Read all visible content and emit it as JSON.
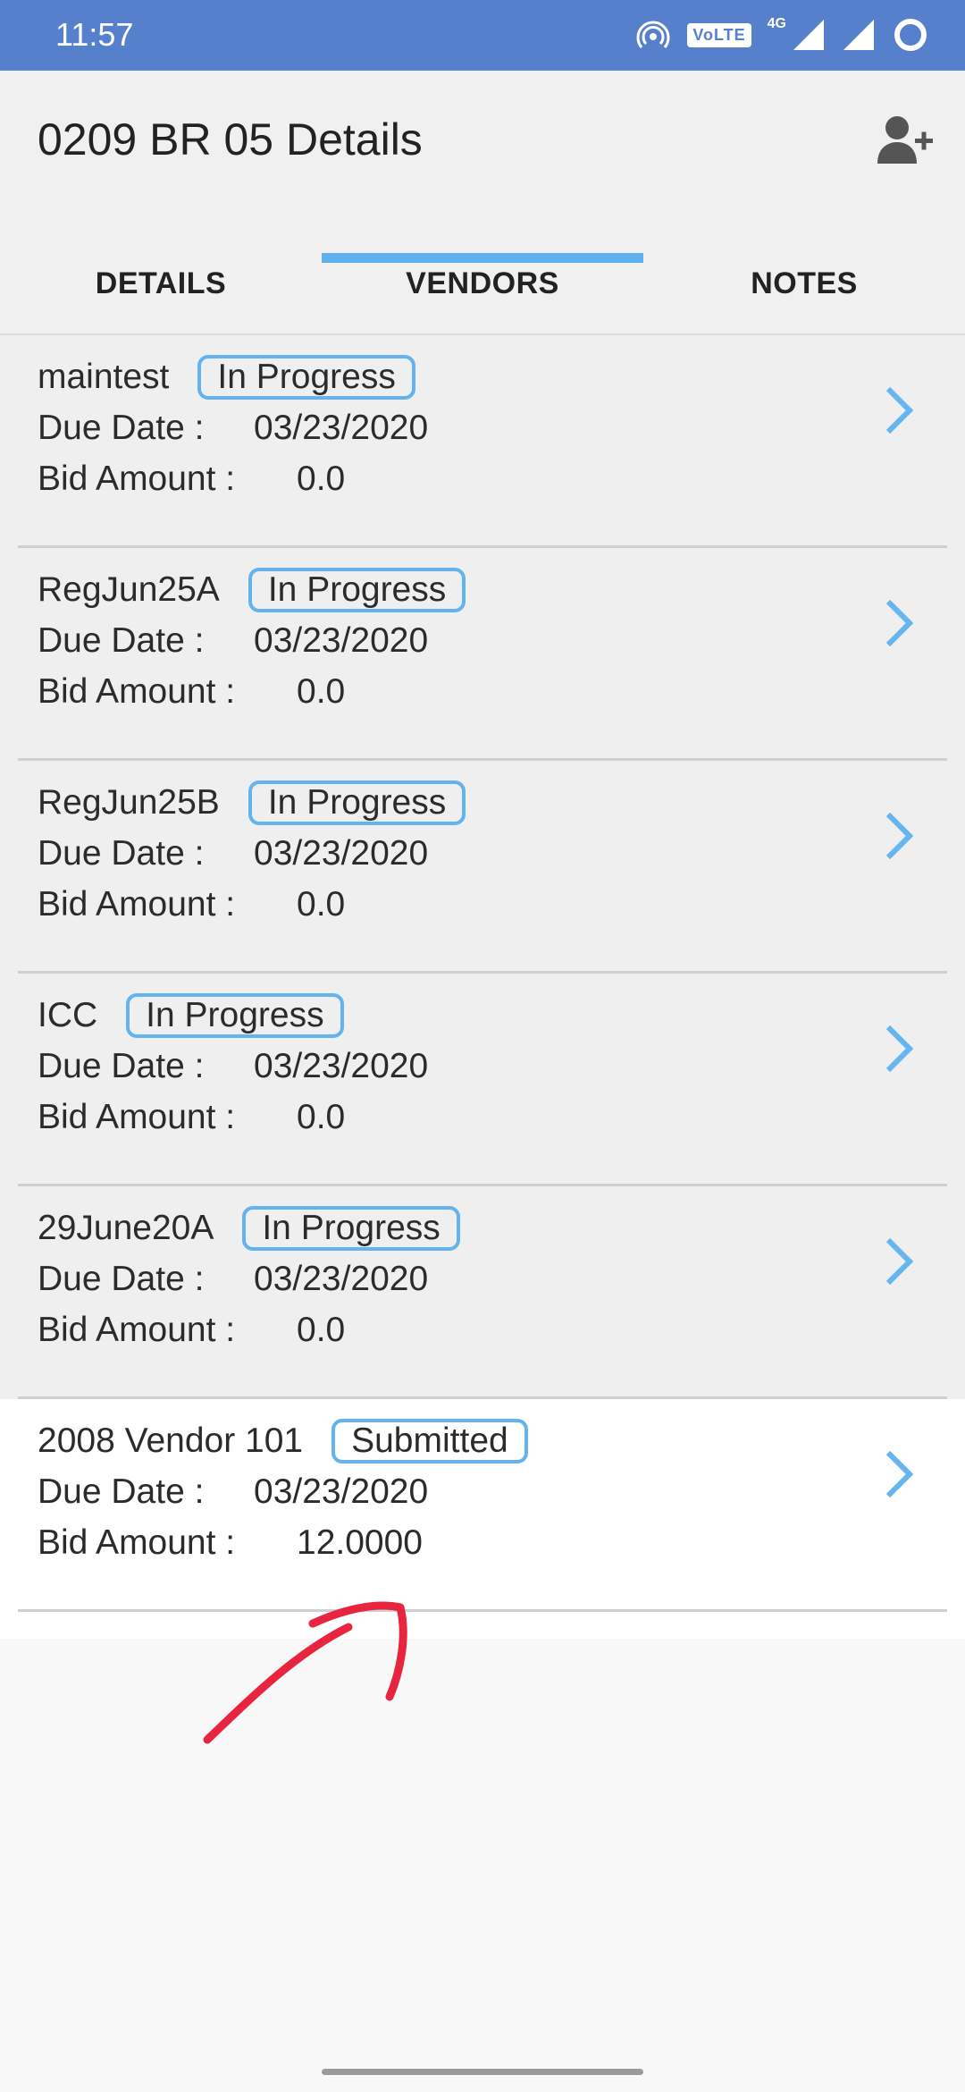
{
  "status_bar": {
    "time": "11:57",
    "volte": "VoLTE",
    "network": "4G"
  },
  "header": {
    "title": "0209 BR 05 Details"
  },
  "tabs": [
    {
      "label": "DETAILS",
      "active": false
    },
    {
      "label": "VENDORS",
      "active": true
    },
    {
      "label": "NOTES",
      "active": false
    }
  ],
  "labels": {
    "due_date": "Due Date :",
    "bid_amount": "Bid Amount :"
  },
  "vendors": [
    {
      "name": "maintest",
      "status": "In Progress",
      "due_date": "03/23/2020",
      "bid_amount": "0.0"
    },
    {
      "name": "RegJun25A",
      "status": "In Progress",
      "due_date": "03/23/2020",
      "bid_amount": "0.0"
    },
    {
      "name": "RegJun25B",
      "status": "In Progress",
      "due_date": "03/23/2020",
      "bid_amount": "0.0"
    },
    {
      "name": "ICC",
      "status": "In Progress",
      "due_date": "03/23/2020",
      "bid_amount": "0.0"
    },
    {
      "name": "29June20A",
      "status": "In Progress",
      "due_date": "03/23/2020",
      "bid_amount": "0.0"
    },
    {
      "name": "2008 Vendor 101",
      "status": "Submitted",
      "due_date": "03/23/2020",
      "bid_amount": "12.0000"
    }
  ],
  "colors": {
    "status_bar": "#5680cc",
    "accent": "#5fb0ee",
    "badge_border": "#62b3f0",
    "annotation": "#e8253f"
  },
  "icons": {
    "header_action": "add-user-icon",
    "row_action": "chevron-right-icon"
  }
}
